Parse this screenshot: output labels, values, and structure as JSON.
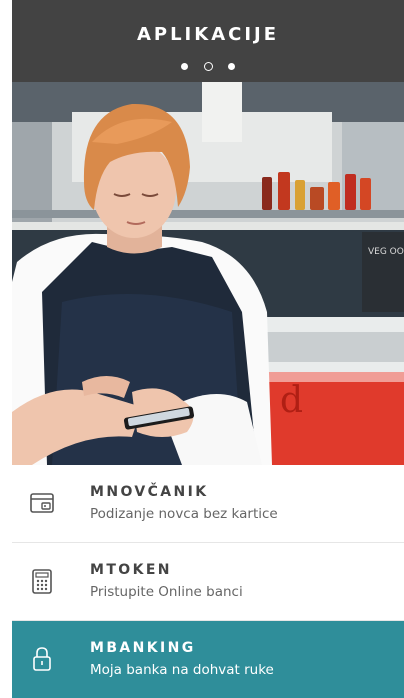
{
  "header": {
    "title": "APLIKACIJE",
    "pagination": {
      "count": 3,
      "active_index": 1
    }
  },
  "hero_image": {
    "alt": "Woman in apron using smartphone at a food truck counter",
    "sign_text": "VEG OOD",
    "counter_letter": "d"
  },
  "menu": {
    "items": [
      {
        "name": "MNOVČANIK",
        "subtitle": "Podizanje novca bez kartice",
        "icon": "wallet-icon",
        "active": false
      },
      {
        "name": "MTOKEN",
        "subtitle": "Pristupite Online banci",
        "icon": "token-keypad-icon",
        "active": false
      },
      {
        "name": "MBANKING",
        "subtitle": "Moja banka na dohvat ruke",
        "icon": "lock-icon",
        "active": true
      }
    ]
  },
  "colors": {
    "header_bg": "#434343",
    "active_bg": "#2f8e9a",
    "text_dark": "#444444",
    "text_sub": "#666666"
  }
}
